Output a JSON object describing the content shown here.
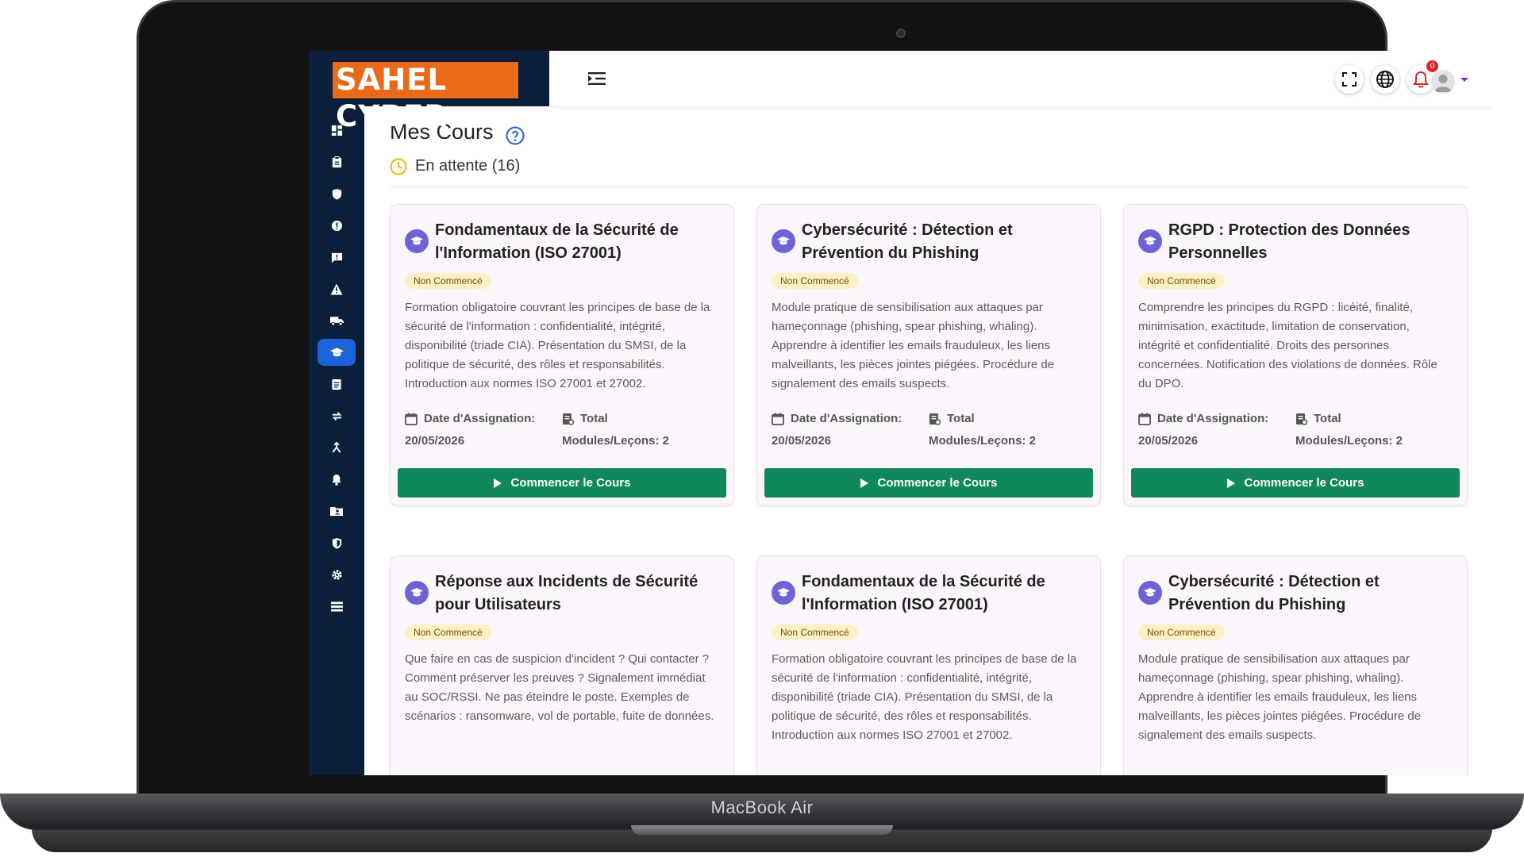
{
  "brand": {
    "logo_text": "SAHEL CYBER",
    "device_label": "MacBook Air"
  },
  "sidebar": {
    "items": [
      {
        "icon": "dashboard-icon"
      },
      {
        "icon": "clipboard-icon"
      },
      {
        "icon": "shield-icon"
      },
      {
        "icon": "alert-circle-icon"
      },
      {
        "icon": "message-alert-icon"
      },
      {
        "icon": "warning-triangle-icon"
      },
      {
        "icon": "truck-icon"
      },
      {
        "icon": "graduation-cap-icon",
        "active": true
      },
      {
        "icon": "document-icon"
      },
      {
        "icon": "sync-icon"
      },
      {
        "icon": "person-branch-icon"
      },
      {
        "icon": "bell-icon"
      },
      {
        "icon": "folder-user-icon"
      },
      {
        "icon": "shield-check-icon"
      },
      {
        "icon": "gear-icon"
      },
      {
        "icon": "list-icon"
      }
    ]
  },
  "topbar": {
    "notification_count": "0",
    "icons": [
      "fullscreen-icon",
      "globe-icon",
      "bell-icon",
      "avatar"
    ]
  },
  "page": {
    "title": "Mes Cours",
    "status_label": "En attente (16)"
  },
  "colors": {
    "sidebar": "#0b1f3a",
    "active": "#1b63d6",
    "primary_button": "#10885a",
    "logo_bg": "#ea6a1a",
    "badge_bg": "#fdf0c7"
  },
  "cards": [
    {
      "title": "Fondamentaux de la Sécurité de l'Information (ISO 27001)",
      "status": "Non Commencé",
      "description": "Formation obligatoire couvrant les principes de base de la sécurité de l'information : confidentialité, intégrité, disponibilité (triade CIA). Présentation du SMSI, de la politique de sécurité, des rôles et responsabilités. Introduction aux normes ISO 27001 et 27002.",
      "date_label": "Date d'Assignation:",
      "date_value": "20/05/2026",
      "total_label": "Total",
      "total_value": "Modules/Leçons: 2",
      "button": "Commencer le Cours"
    },
    {
      "title": "Cybersécurité : Détection et Prévention du Phishing",
      "status": "Non Commencé",
      "description": "Module pratique de sensibilisation aux attaques par hameçonnage (phishing, spear phishing, whaling). Apprendre à identifier les emails frauduleux, les liens malveillants, les pièces jointes piégées. Procédure de signalement des emails suspects.",
      "date_label": "Date d'Assignation:",
      "date_value": "20/05/2026",
      "total_label": "Total",
      "total_value": "Modules/Leçons: 2",
      "button": "Commencer le Cours"
    },
    {
      "title": "RGPD : Protection des Données Personnelles",
      "status": "Non Commencé",
      "description": "Comprendre les principes du RGPD : licéité, finalité, minimisation, exactitude, limitation de conservation, intégrité et confidentialité. Droits des personnes concernées. Notification des violations de données. Rôle du DPO.",
      "date_label": "Date d'Assignation:",
      "date_value": "20/05/2026",
      "total_label": "Total",
      "total_value": "Modules/Leçons: 2",
      "button": "Commencer le Cours"
    },
    {
      "title": "Réponse aux Incidents de Sécurité pour Utilisateurs",
      "status": "Non Commencé",
      "description": "Que faire en cas de suspicion d'incident ? Qui contacter ? Comment préserver les preuves ? Signalement immédiat au SOC/RSSI. Ne pas éteindre le poste. Exemples de scénarios : ransomware, vol de portable, fuite de données."
    },
    {
      "title": "Fondamentaux de la Sécurité de l'Information (ISO 27001)",
      "status": "Non Commencé",
      "description": "Formation obligatoire couvrant les principes de base de la sécurité de l'information : confidentialité, intégrité, disponibilité (triade CIA). Présentation du SMSI, de la politique de sécurité, des rôles et responsabilités. Introduction aux normes ISO 27001 et 27002."
    },
    {
      "title": "Cybersécurité : Détection et Prévention du Phishing",
      "status": "Non Commencé",
      "description": "Module pratique de sensibilisation aux attaques par hameçonnage (phishing, spear phishing, whaling). Apprendre à identifier les emails frauduleux, les liens malveillants, les pièces jointes piégées. Procédure de signalement des emails suspects."
    }
  ]
}
